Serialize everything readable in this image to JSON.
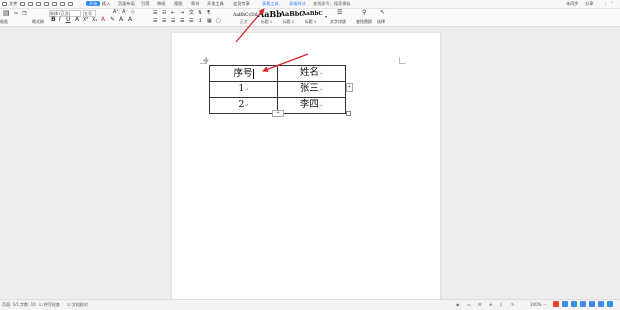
{
  "menu": {
    "items": [
      "文件",
      "开始",
      "插入",
      "页面布局",
      "引用",
      "审阅",
      "视图",
      "章节",
      "开发工具",
      "会员专享",
      "表格工具",
      "表格样式",
      "查找命令、搜索模板"
    ],
    "active": "开始"
  },
  "topright": {
    "sync": "未同步",
    "share": "分享"
  },
  "ribbon": {
    "paste": "粘贴",
    "format_painter": "格式刷",
    "font_name": "宋体 (正文)",
    "font_size": "五号",
    "styles": [
      {
        "sample": "AaBbCcDd",
        "name": "正文"
      },
      {
        "sample": "AaBb",
        "name": "标题 1"
      },
      {
        "sample": "AaBbC",
        "name": "标题 2"
      },
      {
        "sample": "AaBbC",
        "name": "标题 3"
      }
    ],
    "text_tools": "文字排版",
    "find_replace": "查找替换",
    "select": "选择"
  },
  "table": {
    "rows": [
      [
        "序号",
        "姓名"
      ],
      [
        "1",
        "张三"
      ],
      [
        "2",
        "李四"
      ]
    ]
  },
  "status": {
    "page": "页面: 1/1",
    "words": "字数: 10",
    "spell": "拼写检查",
    "doc_check": "文档校对",
    "zoom": "100%"
  },
  "colors": {
    "accent": "#2f86f6",
    "arrow": "#d9262b"
  }
}
